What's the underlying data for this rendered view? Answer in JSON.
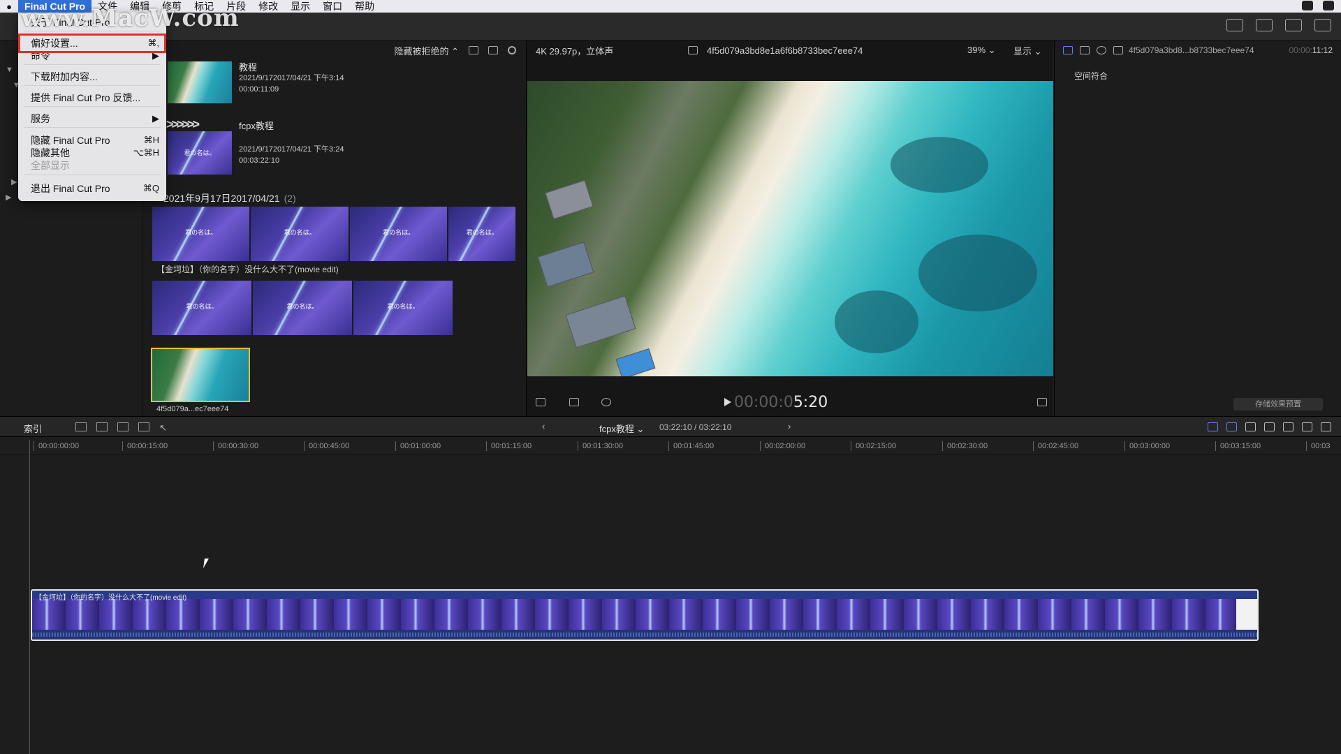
{
  "menubar": {
    "app": "Final Cut Pro",
    "items": [
      "文件",
      "编辑",
      "修剪",
      "标记",
      "片段",
      "修改",
      "显示",
      "窗口",
      "帮助"
    ]
  },
  "watermark": "www.MacW.com",
  "app_menu": {
    "about": "关于 Final Cut Pro",
    "preferences": {
      "label": "偏好设置...",
      "shortcut": "⌘,"
    },
    "commands": "命令",
    "download": "下载附加内容...",
    "feedback": "提供 Final Cut Pro 反馈...",
    "services": "服务",
    "hide": {
      "label": "隐藏 Final Cut Pro",
      "shortcut": "⌘H"
    },
    "hide_others": {
      "label": "隐藏其他",
      "shortcut": "⌥⌘H"
    },
    "show_all": "全部显示",
    "quit": {
      "label": "退出 Final Cut Pro",
      "shortcut": "⌘Q"
    }
  },
  "browser": {
    "filter": "隐藏被拒绝的",
    "clip1": {
      "name": "教程",
      "date": "2021/9/172017/04/21 下午3:14",
      "duration": "00:00:11:09"
    },
    "clip2": {
      "name": "fcpx教程",
      "date": "2021/9/172017/04/21 下午3:24",
      "duration": "00:03:22:10"
    },
    "group": {
      "title": "2021年9月17日2017/04/21",
      "count": "(2)"
    },
    "clip3": {
      "name": "【金坷垃】（你的名字）没什么大不了(movie edit)"
    },
    "clip4": {
      "name": "4f5d079a...ec7eee74"
    },
    "thumb_text": "君の名は。"
  },
  "viewer": {
    "format": "4K 29.97p，立体声",
    "clip_name": "4f5d079a3bd8e1a6f6b8733bec7eee74",
    "zoom": "39%",
    "display": "显示",
    "timecode_dim": "00:00:0",
    "timecode_hi": "5:20"
  },
  "inspector": {
    "clip_name": "4f5d079a3bd8...b8733bec7eee74",
    "duration_dim": "00:00:",
    "duration_hi": "11:12",
    "label": "空间符合",
    "save_preset": "存储效果预置"
  },
  "timeline_bar": {
    "index": "索引",
    "project": "fcpx教程",
    "duration": "03:22:10 / 03:22:10"
  },
  "ruler": [
    "00:00:00:00",
    "00:00:15:00",
    "00:00:30:00",
    "00:00:45:00",
    "00:01:00:00",
    "00:01:15:00",
    "00:01:30:00",
    "00:01:45:00",
    "00:02:00:00",
    "00:02:15:00",
    "00:02:30:00",
    "00:02:45:00",
    "00:03:00:00",
    "00:03:15:00",
    "00:03"
  ],
  "timeline_clip": {
    "label": "【金坷垃】（你的名字）没什么大不了(movie edit)"
  }
}
